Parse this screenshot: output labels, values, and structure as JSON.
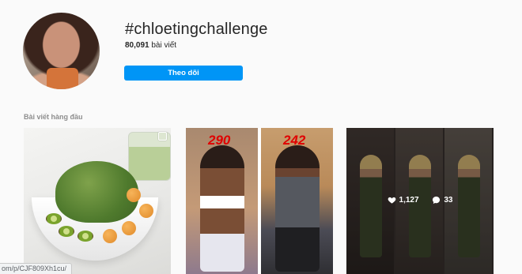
{
  "header": {
    "hashtag": "#chloetingchallenge",
    "post_count": "80,091",
    "post_count_unit": "bài viết",
    "follow_label": "Theo dõi"
  },
  "top_posts": {
    "section_label": "Bài viết hàng đầu",
    "post2": {
      "score_left": "290",
      "score_right": "242"
    },
    "post3": {
      "likes": "1,127",
      "comments": "33"
    }
  },
  "status_bar": {
    "url_text": "om/p/CJF809Xh1cu/"
  },
  "colors": {
    "follow_button": "#0095f6",
    "score_text": "#e00000"
  }
}
